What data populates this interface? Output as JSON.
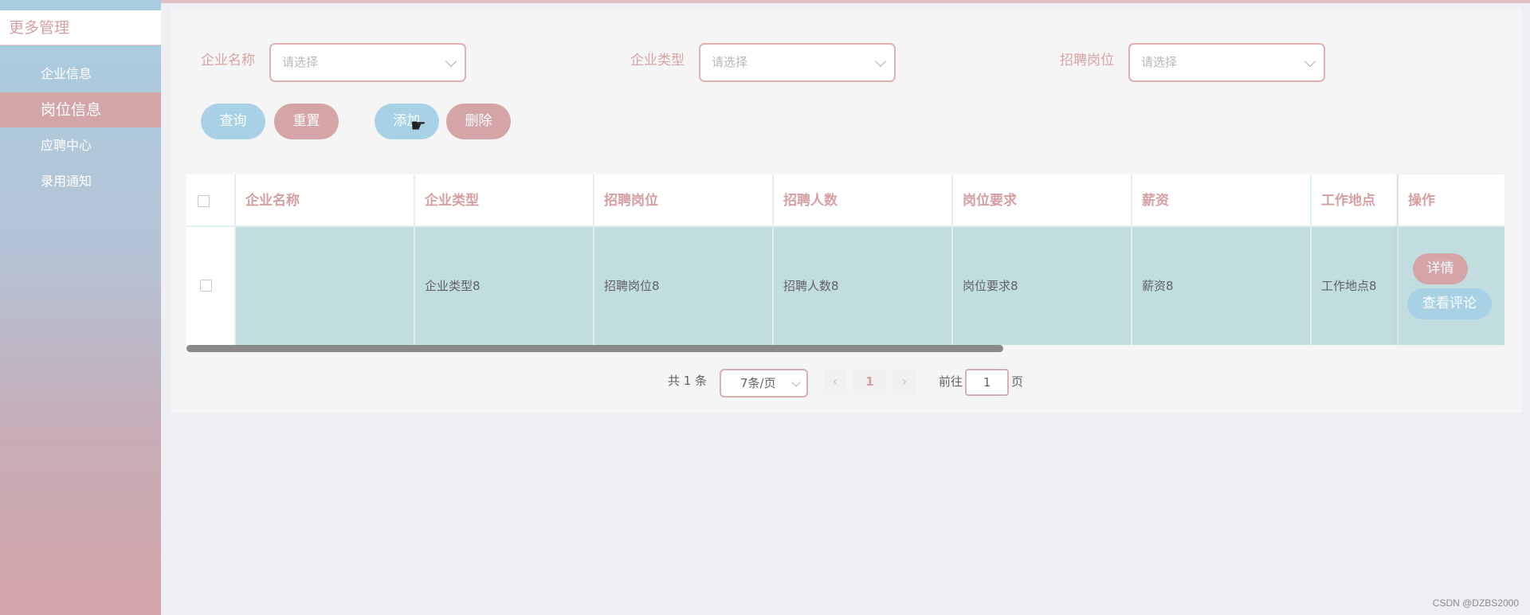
{
  "sidebar": {
    "header": "更多管理",
    "items": [
      {
        "label": "企业信息",
        "active": false
      },
      {
        "label": "岗位信息",
        "active": true
      },
      {
        "label": "应聘中心",
        "active": false
      },
      {
        "label": "录用通知",
        "active": false
      }
    ]
  },
  "filters": [
    {
      "label": "企业名称",
      "placeholder": "请选择"
    },
    {
      "label": "企业类型",
      "placeholder": "请选择"
    },
    {
      "label": "招聘岗位",
      "placeholder": "请选择"
    }
  ],
  "buttons": {
    "search": "查询",
    "reset": "重置",
    "add": "添加",
    "delete": "删除"
  },
  "table": {
    "columns": [
      "企业名称",
      "企业类型",
      "招聘岗位",
      "招聘人数",
      "岗位要求",
      "薪资",
      "工作地点",
      "操作"
    ],
    "rows": [
      {
        "company_name": "",
        "company_type": "企业类型8",
        "position": "招聘岗位8",
        "headcount": "招聘人数8",
        "requirements": "岗位要求8",
        "salary": "薪资8",
        "location": "工作地点8",
        "actions": {
          "detail": "详情",
          "comments": "查看评论"
        }
      }
    ]
  },
  "pagination": {
    "total": "共 1 条",
    "page_size": "7条/页",
    "prev": "‹",
    "next": "›",
    "current_page": "1",
    "goto_label": "前往",
    "goto_value": "1",
    "page_suffix": "页"
  },
  "watermark": "CSDN @DZBS2000",
  "colors": {
    "accent_pink": "#d5a4a6",
    "accent_blue": "#a8d1e6",
    "row_highlight": "#c1dde0"
  }
}
